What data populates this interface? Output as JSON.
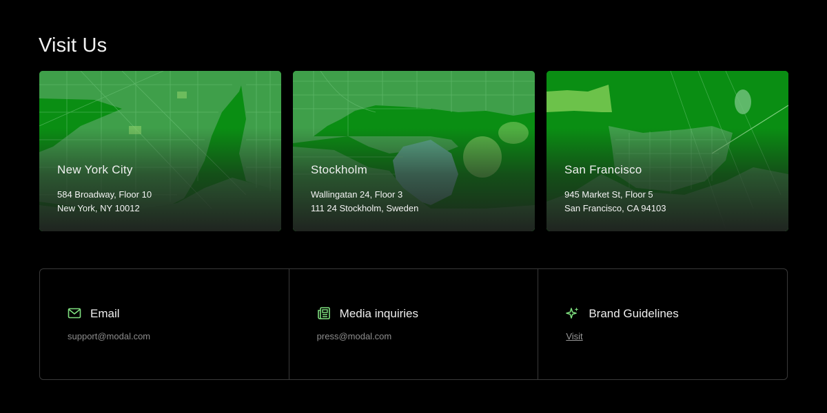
{
  "page": {
    "title": "Visit Us"
  },
  "locations": [
    {
      "city": "New York City",
      "address_line1": "584 Broadway, Floor 10",
      "address_line2": "New York, NY 10012"
    },
    {
      "city": "Stockholm",
      "address_line1": "Wallingatan 24, Floor 3",
      "address_line2": "111 24 Stockholm, Sweden"
    },
    {
      "city": "San Francisco",
      "address_line1": "945 Market St, Floor 5",
      "address_line2": "San Francisco, CA 94103"
    }
  ],
  "contacts": [
    {
      "icon": "mail-icon",
      "label": "Email",
      "value": "support@modal.com"
    },
    {
      "icon": "newspaper-icon",
      "label": "Media inquiries",
      "value": "press@modal.com"
    },
    {
      "icon": "sparkles-icon",
      "label": "Brand Guidelines",
      "link_text": "Visit"
    }
  ],
  "colors": {
    "background": "#000000",
    "accent": "#7fe07f",
    "map_green": "#0b8a14",
    "border": "#3a3a3a"
  }
}
